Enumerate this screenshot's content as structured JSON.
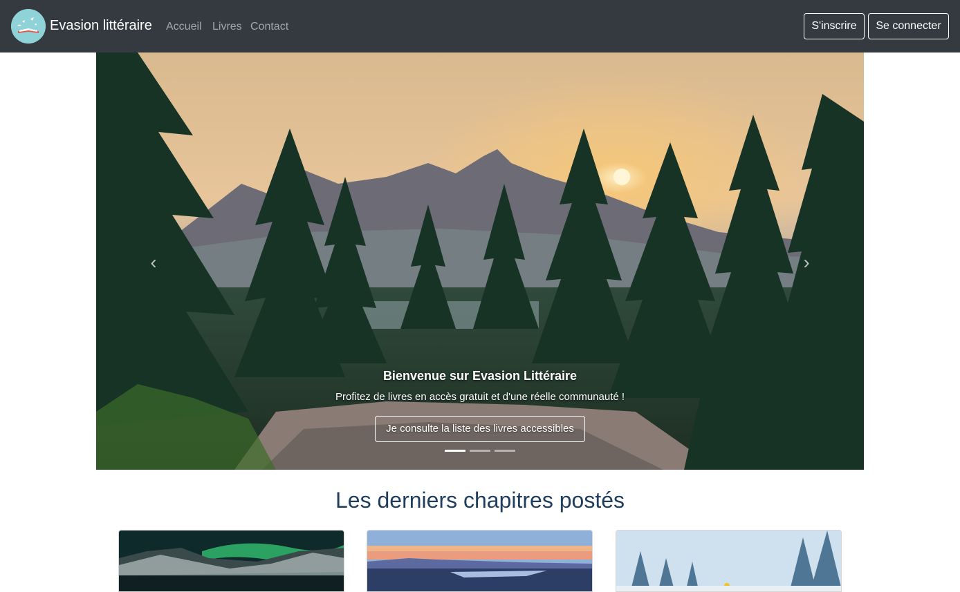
{
  "navbar": {
    "brand": "Evasion littéraire",
    "links": [
      "Accueil",
      "Livres",
      "Contact"
    ],
    "signup_label": "S'inscrire",
    "login_label": "Se connecter"
  },
  "carousel": {
    "title": "Bienvenue sur Evasion Littéraire",
    "text": "Profitez de livres en accès gratuit et d'une réelle communauté !",
    "button_label": "Je consulte la liste des livres accessibles",
    "prev_icon": "‹",
    "next_icon": "›",
    "slide_count": 3,
    "active_slide": 1
  },
  "section": {
    "title": "Les derniers chapitres postés"
  },
  "colors": {
    "navbar_bg": "#343a40",
    "section_title": "#1f3d5c"
  }
}
